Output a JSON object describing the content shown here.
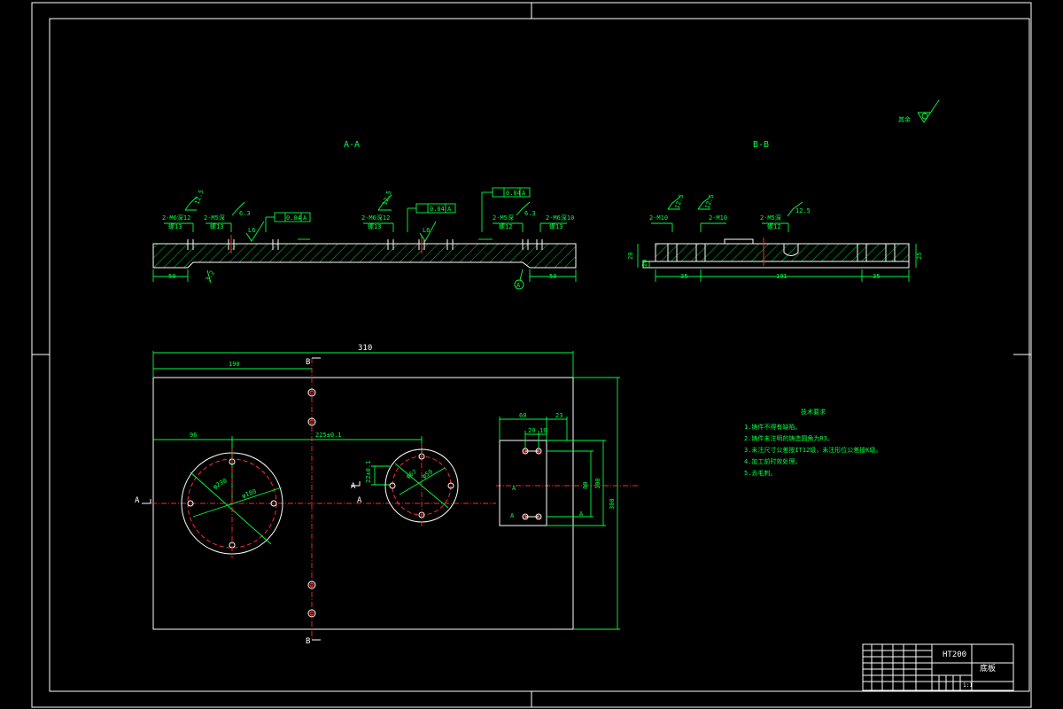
{
  "views": {
    "section_aa_label": "A-A",
    "section_bb_label": "B-B"
  },
  "aa_dims": {
    "left": "50",
    "right": "50",
    "roughness_bottom": "3.2",
    "hole1": "2-M6深12",
    "hole1_sub": "螺13",
    "hole2": "2-M5深",
    "hole2_sub": "螺13",
    "hole3": "2-M6深12",
    "hole3_sub": "螺13",
    "hole4": "2-M5深",
    "hole4_sub": "螺12",
    "hole5": "2-M6深10",
    "hole5_sub": "螺13",
    "rough1": "12.5",
    "rough2": "6.3",
    "rough3": "12.5",
    "rough4": "6.3",
    "rough5": "6.3",
    "rough_l1": "L6",
    "rough_l2": "L6",
    "tol1": "0.04",
    "tol2": "0.04",
    "tol3": "0.04",
    "datum": "A",
    "datum_circle": "A"
  },
  "bb_dims": {
    "left": "35",
    "mid": "191",
    "right": "35",
    "height_left": "20",
    "height_left2": "20",
    "height_right": "25",
    "hole1": "2-M10",
    "hole2": "2-M10",
    "hole3": "2-M5深",
    "hole3_sub": "螺12",
    "rough1": "12.5",
    "rough2": "12.5",
    "rough3": "12.5"
  },
  "plan": {
    "overall_width": "310",
    "dim_190": "190",
    "dim_96": "96",
    "dim_center": "225±0.1",
    "height_300": "300",
    "dim_22": "22±0.1",
    "dim_60": "60",
    "dim_23": "23",
    "dim_20": "20",
    "dim_10": "10",
    "dim_80": "80",
    "dim_100": "100",
    "circle_l1": "φ230",
    "circle_l2": "φ180",
    "circle_s1": "φ67",
    "circle_s2": "φ59",
    "sec_a_left": "A",
    "sec_a_right": "A",
    "sec_a_mid": "A",
    "sec_b_top": "B",
    "sec_b_bot": "B",
    "view_a1": "A",
    "view_a2": "A",
    "view_a3": "A"
  },
  "notes": {
    "title": "技术要求",
    "items": [
      "1.铸件不得有缺陷。",
      "2.铸件未注明的铸造圆角为R3。",
      "3.未注尺寸公差按IT12级，未注形位公差按K级。",
      "4.加工前时效处理。",
      "5.去毛刺。"
    ]
  },
  "roughness_mark": "其余",
  "title_block": {
    "material": "HT200",
    "name": "底板",
    "scale": "1:1"
  }
}
